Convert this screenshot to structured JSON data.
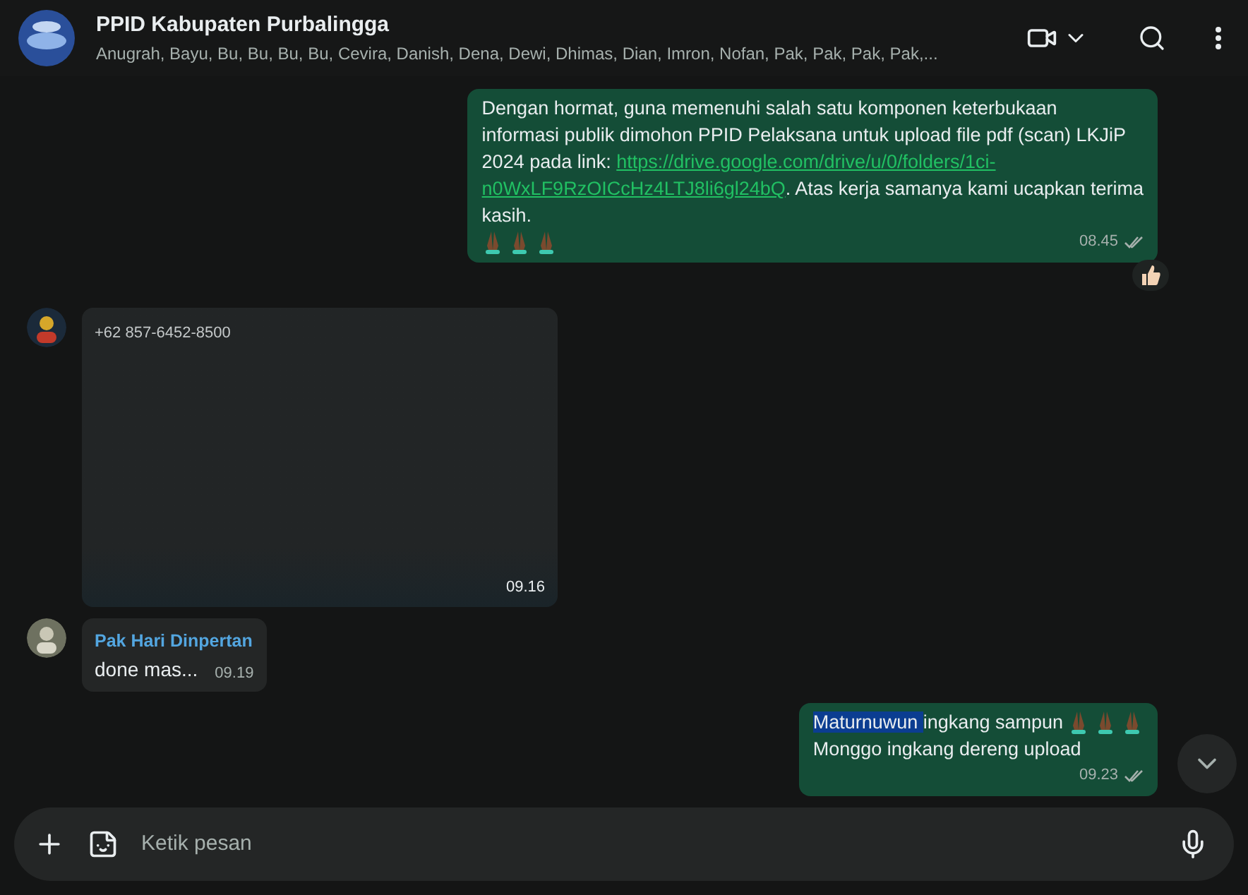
{
  "header": {
    "title": "PPID Kabupaten Purbalingga",
    "members": "Anugrah, Bayu, Bu, Bu, Bu, Bu, Cevira, Danish, Dena, Dewi, Dhimas, Dian, Imron, Nofan, Pak, Pak, Pak, Pak,..."
  },
  "messages": [
    {
      "kind": "outgoing_text",
      "lines": [
        [
          {
            "text": "Dengan hormat, guna memenuhi salah satu komponen keterbukaan"
          }
        ],
        [
          {
            "text": "informasi publik dimohon PPID Pelaksana untuk upload file pdf (scan) LKJiP"
          }
        ],
        [
          {
            "text": "2024 pada link: "
          },
          {
            "text": "https://drive.google.com/drive/u/0/folders/1ci-",
            "link": true
          }
        ],
        [
          {
            "text": "n0WxLF9RzOICcHz4LTJ8li6gl24bQ",
            "link": true
          },
          {
            "text": ". Atas kerja samanya kami ucapkan terima"
          }
        ],
        [
          {
            "text": "kasih."
          }
        ]
      ],
      "prayer_emojis": true,
      "time": "08.45",
      "read": true,
      "reacted": true
    },
    {
      "kind": "incoming_media",
      "sender": "+62 857-6452-8500",
      "time": "09.16"
    },
    {
      "kind": "incoming_text",
      "sender": "Pak Hari Dinpertan",
      "lines": [
        [
          {
            "text": "done mas..."
          }
        ]
      ],
      "time": "09.19"
    },
    {
      "kind": "outgoing_text",
      "lines": [
        [
          {
            "text": "Maturnuwun ",
            "highlighted": true
          },
          {
            "text": "ingkang sampun"
          }
        ],
        [
          {
            "text": "Monggo ingkang dereng upload"
          }
        ]
      ],
      "inline_prayer_emojis": true,
      "time": "09.23",
      "read": true
    }
  ],
  "composer": {
    "placeholder": "Ketik pesan"
  }
}
